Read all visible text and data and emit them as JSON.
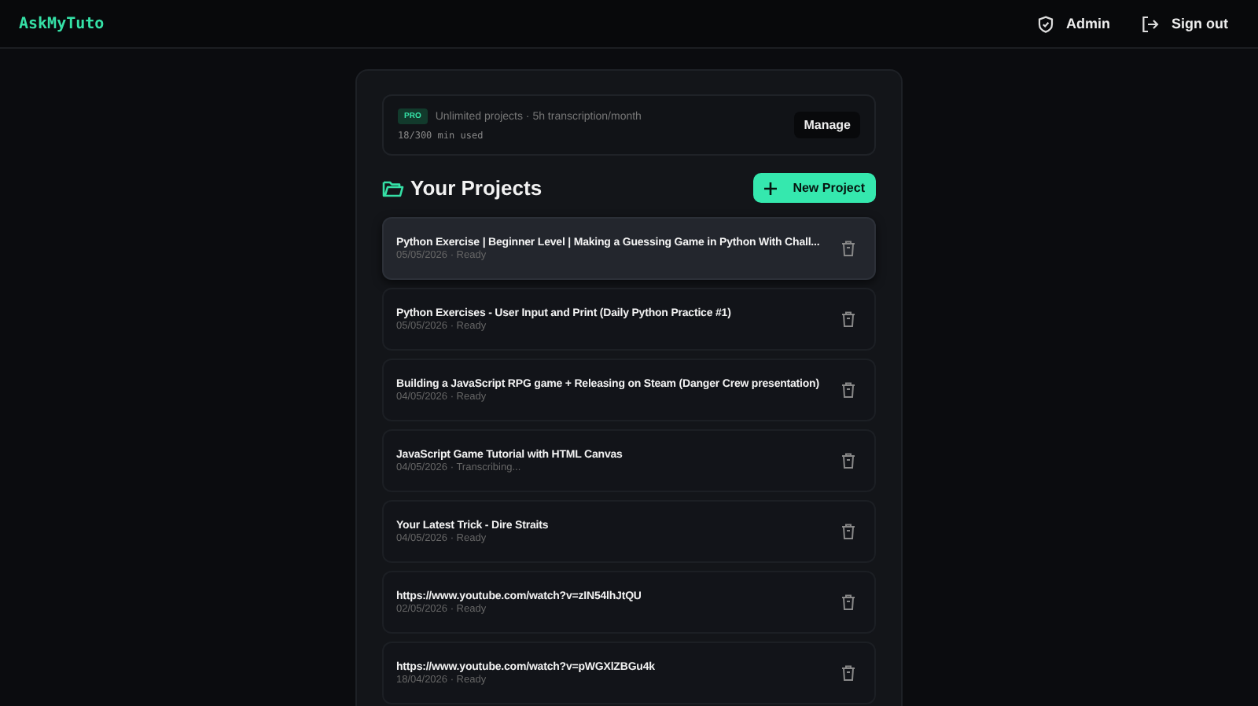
{
  "header": {
    "logo": "AskMyTuto",
    "links": [
      {
        "kind": "admin",
        "label": "Admin"
      },
      {
        "kind": "signout",
        "label": "Sign out"
      }
    ]
  },
  "plan": {
    "badge": "PRO",
    "description": "Unlimited projects · 5h transcription/month",
    "usage": "18/300 min used",
    "manage_button": "Manage"
  },
  "projects": {
    "title": "Your Projects",
    "new_button": "New Project",
    "items": [
      {
        "title": "Python Exercise | Beginner Level | Making a Guessing Game in Python With Chall...",
        "meta": "05/05/2026 · Ready",
        "hovered": true
      },
      {
        "title": "Python Exercises - User Input and Print (Daily Python Practice #1)",
        "meta": "05/05/2026 · Ready",
        "hovered": false
      },
      {
        "title": "Building a JavaScript RPG game + Releasing on Steam (Danger Crew presentation)",
        "meta": "04/05/2026 · Ready",
        "hovered": false
      },
      {
        "title": "JavaScript Game Tutorial with HTML Canvas",
        "meta": "04/05/2026 · Transcribing...",
        "hovered": false
      },
      {
        "title": "Your Latest Trick - Dire Straits",
        "meta": "04/05/2026 · Ready",
        "hovered": false
      },
      {
        "title": "https://www.youtube.com/watch?v=zIN54lhJtQU",
        "meta": "02/05/2026 · Ready",
        "hovered": false
      },
      {
        "title": "https://www.youtube.com/watch?v=pWGXlZBGu4k",
        "meta": "18/04/2026 · Ready",
        "hovered": false
      }
    ]
  }
}
